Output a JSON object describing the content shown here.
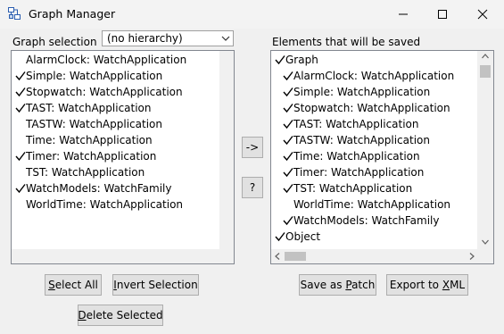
{
  "window": {
    "title": "Graph Manager"
  },
  "left": {
    "label": "Graph selection",
    "dropdown_value": "(no hierarchy)",
    "items": [
      {
        "label": "AlarmClock: WatchApplication",
        "checked": false
      },
      {
        "label": "Simple: WatchApplication",
        "checked": true
      },
      {
        "label": "Stopwatch: WatchApplication",
        "checked": true
      },
      {
        "label": "TAST: WatchApplication",
        "checked": true
      },
      {
        "label": "TASTW: WatchApplication",
        "checked": false
      },
      {
        "label": "Time: WatchApplication",
        "checked": false
      },
      {
        "label": "Timer: WatchApplication",
        "checked": true
      },
      {
        "label": "TST: WatchApplication",
        "checked": false
      },
      {
        "label": "WatchModels: WatchFamily",
        "checked": true
      },
      {
        "label": "WorldTime: WatchApplication",
        "checked": false
      }
    ]
  },
  "middle": {
    "transfer_label": "->",
    "help_label": "?"
  },
  "right": {
    "label": "Elements that will be saved",
    "items": [
      {
        "label": "Graph",
        "checked": true,
        "indent": 0
      },
      {
        "label": "AlarmClock: WatchApplication",
        "checked": true,
        "indent": 1
      },
      {
        "label": "Simple: WatchApplication",
        "checked": true,
        "indent": 1
      },
      {
        "label": "Stopwatch: WatchApplication",
        "checked": true,
        "indent": 1
      },
      {
        "label": "TAST: WatchApplication",
        "checked": true,
        "indent": 1
      },
      {
        "label": "TASTW: WatchApplication",
        "checked": true,
        "indent": 1
      },
      {
        "label": "Time: WatchApplication",
        "checked": true,
        "indent": 1
      },
      {
        "label": "Timer: WatchApplication",
        "checked": true,
        "indent": 1
      },
      {
        "label": "TST: WatchApplication",
        "checked": true,
        "indent": 1
      },
      {
        "label": "WorldTime: WatchApplication",
        "checked": false,
        "indent": 1
      },
      {
        "label": "WatchModels: WatchFamily",
        "checked": true,
        "indent": 1
      },
      {
        "label": "Object",
        "checked": true,
        "indent": 0
      }
    ]
  },
  "buttons": {
    "select_all": {
      "pre": "",
      "u": "S",
      "post": "elect All"
    },
    "invert": {
      "pre": "",
      "u": "I",
      "post": "nvert Selection"
    },
    "delete": {
      "pre": "",
      "u": "D",
      "post": "elete Selected"
    },
    "save_patch": {
      "pre": "Save as ",
      "u": "P",
      "post": "atch"
    },
    "export_xml": {
      "pre": "Export to ",
      "u": "X",
      "post": "ML"
    }
  }
}
